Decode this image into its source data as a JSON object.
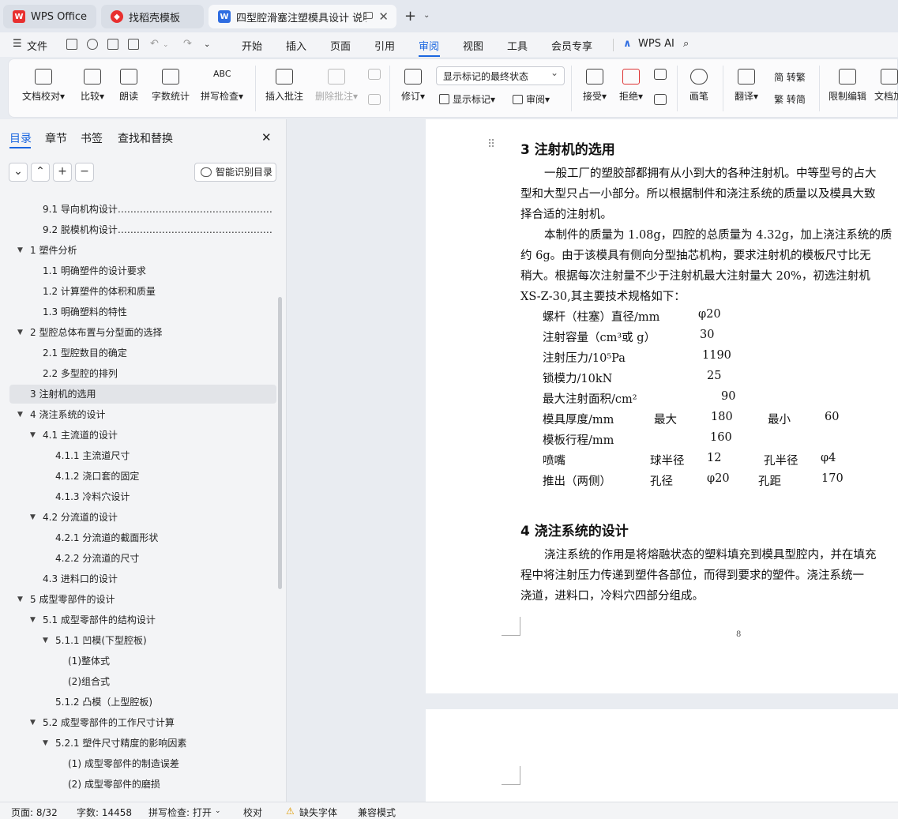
{
  "tabs": {
    "wps": "WPS Office",
    "daoke": "找稻壳模板",
    "doc": "四型腔滑塞注塑模具设计 说明"
  },
  "menu": {
    "file": "文件",
    "items": [
      "开始",
      "插入",
      "页面",
      "引用",
      "审阅",
      "视图",
      "工具",
      "会员专享"
    ],
    "active": "审阅",
    "ai": "WPS AI"
  },
  "ribbon": {
    "doc_proof": "文档校对",
    "compare": "比较",
    "read": "朗读",
    "word_count": "字数统计",
    "spell_check": "拼写检查",
    "insert_comment": "插入批注",
    "delete_comment": "删除批注",
    "revise": "修订",
    "show_mode": "显示标记的最终状态",
    "show_markup": "显示标记",
    "review": "审阅",
    "accept": "接受",
    "reject": "拒绝",
    "pen": "画笔",
    "translate": "翻译",
    "trad": "简 转繁",
    "simp": "繁 转简",
    "restrict": "限制编辑",
    "doc_more": "文档加"
  },
  "panel": {
    "tabs": [
      "目录",
      "章节",
      "书签",
      "查找和替换"
    ],
    "smart_btn": "智能识别目录",
    "toc": [
      {
        "label": "9.1  导向机构设计………………………………………………………",
        "level": 2
      },
      {
        "label": "9.2  脱模机构设计………………………………………………………",
        "level": 2
      },
      {
        "label": "1  塑件分析",
        "level": 1
      },
      {
        "label": "1.1  明确塑件的设计要求",
        "level": 2
      },
      {
        "label": "1.2  计算塑件的体积和质量",
        "level": 2
      },
      {
        "label": "1.3  明确塑料的特性",
        "level": 2
      },
      {
        "label": "2  型腔总体布置与分型面的选择",
        "level": 1
      },
      {
        "label": "2.1  型腔数目的确定",
        "level": 2
      },
      {
        "label": "2.2  多型腔的排列",
        "level": 2
      },
      {
        "label": "3 注射机的选用",
        "level": 1
      },
      {
        "label": "4  浇注系统的设计",
        "level": 1
      },
      {
        "label": "4.1  主流道的设计",
        "level": 2
      },
      {
        "label": "4.1.1 主流道尺寸",
        "level": 3
      },
      {
        "label": "4.1.2  浇口套的固定",
        "level": 3
      },
      {
        "label": "4.1.3  冷料穴设计",
        "level": 3
      },
      {
        "label": "4.2  分流道的设计",
        "level": 2
      },
      {
        "label": "4.2.1  分流道的截面形状",
        "level": 3
      },
      {
        "label": "4.2.2  分流道的尺寸",
        "level": 3
      },
      {
        "label": "4.3  进料口的设计",
        "level": 2
      },
      {
        "label": "5  成型零部件的设计",
        "level": 1
      },
      {
        "label": "5.1  成型零部件的结构设计",
        "level": 2
      },
      {
        "label": "5.1.1  凹模(下型腔板)",
        "level": 3
      },
      {
        "label": "(1)整体式",
        "level": 4
      },
      {
        "label": "(2)组合式",
        "level": 4
      },
      {
        "label": "5.1.2  凸模（上型腔板)",
        "level": 3
      },
      {
        "label": "5.2  成型零部件的工作尺寸计算",
        "level": 2
      },
      {
        "label": "5.2.1  塑件尺寸精度的影响因素",
        "level": 3
      },
      {
        "label": "(1)  成型零部件的制造误差",
        "level": 4
      },
      {
        "label": "(2)  成型零部件的磨损",
        "level": 4
      }
    ]
  },
  "doc": {
    "h3": "3  注射机的选用",
    "p1": [
      "一般工厂的塑胶部都拥有从小到大的各种注射机。中等型号的占大",
      "型和大型只占一小部分。所以根据制件和浇注系统的质量以及模具大致",
      "择合适的注射机。"
    ],
    "p2": [
      "本制件的质量为 1.08g，四腔的总质量为 4.32g，加上浇注系统的质",
      "约 6g。由于该模具有侧向分型抽芯机构，要求注射机的模板尺寸比无",
      "稍大。根据每次注射量不少于注射机最大注射量大 20%，初选注射机",
      "XS-Z-30,其主要技术规格如下："
    ],
    "specs": [
      [
        "螺杆（柱塞）直径/mm",
        "φ20"
      ],
      [
        "注射容量（cm³或 g）",
        "30"
      ],
      [
        "注射压力/10⁵Pa",
        "1190"
      ],
      [
        "锁模力/10kN",
        "25"
      ],
      [
        "最大注射面积/cm²",
        "90"
      ],
      [
        "模具厚度/mm",
        "最大",
        "180",
        "最小",
        "60"
      ],
      [
        "模板行程/mm",
        "160"
      ],
      [
        "喷嘴",
        "球半径",
        "12",
        "孔半径",
        "φ4"
      ],
      [
        "推出（两侧）",
        "孔径",
        "φ20",
        "孔距",
        "170"
      ]
    ],
    "h4": "4  浇注系统的设计",
    "p3": [
      "浇注系统的作用是将熔融状态的塑料填充到模具型腔内，并在填充",
      "程中将注射压力传递到塑件各部位，而得到要求的塑件。浇注系统一",
      "浇道，进料口，冷料穴四部分组成。"
    ],
    "page_num": "8"
  },
  "status": {
    "page": "页面: 8/32",
    "words": "字数: 14458",
    "spell": "拼写检查: 打开",
    "proof": "校对",
    "missing_font": "缺失字体",
    "compat": "兼容模式"
  }
}
